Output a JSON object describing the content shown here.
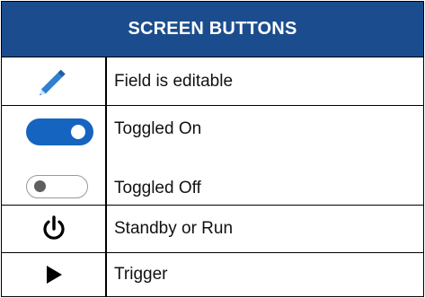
{
  "header": {
    "title": "SCREEN BUTTONS"
  },
  "rows": [
    {
      "icon": "pencil-icon",
      "label": "Field is editable"
    },
    {
      "icon": "toggle-on-icon",
      "label": "Toggled On"
    },
    {
      "icon": "toggle-off-icon",
      "label": "Toggled Off"
    },
    {
      "icon": "power-icon",
      "label": "Standby or Run"
    },
    {
      "icon": "play-icon",
      "label": "Trigger"
    }
  ],
  "colors": {
    "header_bg": "#1b4d8e",
    "header_text": "#ffffff",
    "toggle_on": "#1565c0",
    "pencil": "#2f80d0"
  }
}
